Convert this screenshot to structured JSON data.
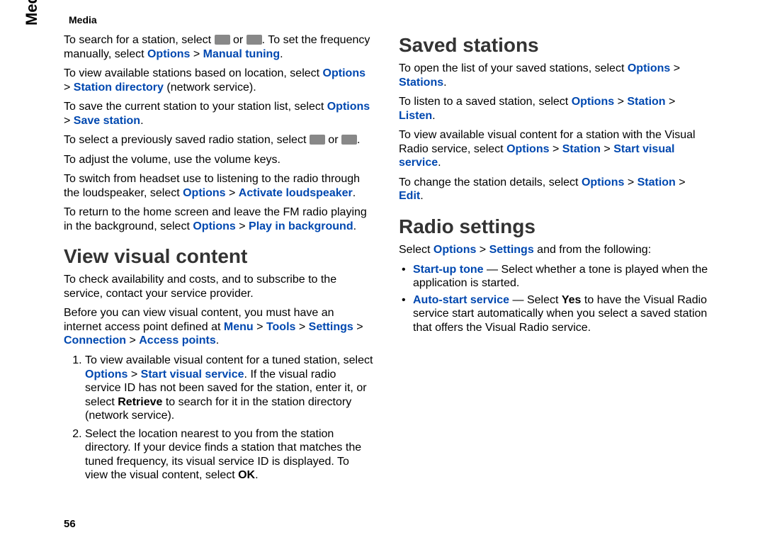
{
  "header": {
    "section": "Media"
  },
  "sidetab": "Media",
  "pagenum": "56",
  "p1": {
    "a": "To search for a station, select ",
    "b": " or ",
    "c": ". To set the frequency manually, select ",
    "d": "Options",
    "e": " > ",
    "f": "Manual tuning",
    "g": "."
  },
  "p2": {
    "a": "To view available stations based on location, select ",
    "b": "Options",
    "c": " > ",
    "d": "Station directory",
    "e": " (network service)."
  },
  "p3": {
    "a": "To save the current station to your station list, select ",
    "b": "Options",
    "c": " > ",
    "d": "Save station",
    "e": "."
  },
  "p4": {
    "a": "To select a previously saved radio station, select ",
    "b": " or ",
    "c": "."
  },
  "p5": "To adjust the volume, use the volume keys.",
  "p6": {
    "a": "To switch from headset use to listening to the radio through the loudspeaker, select ",
    "b": "Options",
    "c": " > ",
    "d": "Activate loudspeaker",
    "e": "."
  },
  "p7": {
    "a": "To return to the home screen and leave the FM radio playing in the background, select ",
    "b": "Options",
    "c": " > ",
    "d": "Play in background",
    "e": "."
  },
  "h1": "View visual content",
  "p8": "To check availability and costs, and to subscribe to the service, contact your service provider.",
  "p9": {
    "a": "Before you can view visual content, you must have an internet access point defined at ",
    "b": "Menu",
    "c": " > ",
    "d": "Tools",
    "e": " > ",
    "f": "Settings",
    "g": " > ",
    "h": "Connection",
    "i": " > ",
    "j": "Access points",
    "k": "."
  },
  "ol1": {
    "li1": {
      "a": "To view available visual content for a tuned station, select ",
      "b": "Options",
      "c": " > ",
      "d": "Start visual service",
      "e": ". If the visual radio service ID has not been saved for the station, enter it, or select ",
      "f": "Retrieve",
      "g": " to search for it in the station directory (network service)."
    },
    "li2": {
      "a": "Select the location nearest to you from the station directory. If your device finds a station that matches the tuned frequency, its visual service ID is displayed. To view the visual content, select ",
      "b": "OK",
      "c": "."
    }
  },
  "h2": "Saved stations",
  "p10": {
    "a": "To open the list of your saved stations, select ",
    "b": "Options",
    "c": " > ",
    "d": "Stations",
    "e": "."
  },
  "p11": {
    "a": "To listen to a saved station, select ",
    "b": "Options",
    "c": " > ",
    "d": "Station",
    "e": " > ",
    "f": "Listen",
    "g": "."
  },
  "p12": {
    "a": "To view available visual content for a station with the Visual Radio service, select ",
    "b": "Options",
    "c": " > ",
    "d": "Station",
    "e": " > ",
    "f": "Start visual service",
    "g": "."
  },
  "p13": {
    "a": "To change the station details, select ",
    "b": "Options",
    "c": " > ",
    "d": "Station",
    "e": " > ",
    "f": "Edit",
    "g": "."
  },
  "h3": "Radio settings",
  "p14": {
    "a": "Select ",
    "b": "Options",
    "c": " > ",
    "d": "Settings",
    "e": " and from the following:"
  },
  "ul1": {
    "li1": {
      "a": "Start-up tone",
      "b": " — Select whether a tone is played when the application is started."
    },
    "li2": {
      "a": "Auto-start service",
      "b": " — Select ",
      "c": "Yes",
      "d": " to have the Visual Radio service start automatically when you select a saved station that offers the Visual Radio service."
    }
  }
}
